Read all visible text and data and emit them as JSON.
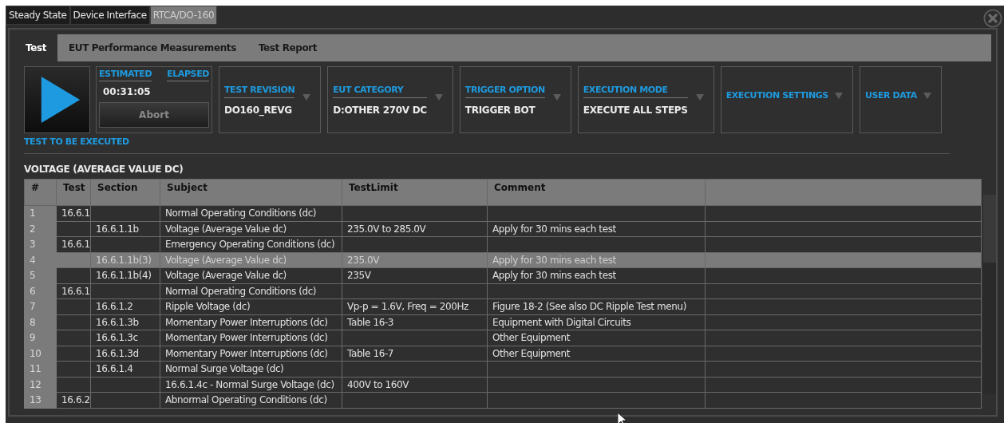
{
  "top_tabs": [
    {
      "label": "Steady State",
      "selected": false
    },
    {
      "label": "Device Interface",
      "selected": false
    },
    {
      "label": "RTCA/DO-160",
      "selected": true
    }
  ],
  "sub_tabs": [
    {
      "label": "Test",
      "selected": true
    },
    {
      "label": "EUT Performance Measurements",
      "selected": false
    },
    {
      "label": "Test Report",
      "selected": false
    }
  ],
  "run_panel": {
    "estimated_label": "ESTIMATED",
    "elapsed_label": "ELAPSED",
    "estimated_time": "00:31:05",
    "abort": {
      "label": "Abort",
      "disabled": true
    },
    "caption": "TEST TO BE EXECUTED"
  },
  "dropdowns": [
    {
      "label": "TEST REVISION",
      "value": "DO160_REVG"
    },
    {
      "label": "EUT CATEGORY",
      "value": "D:OTHER 270V DC"
    },
    {
      "label": "TRIGGER OPTION",
      "value": "TRIGGER BOT"
    },
    {
      "label": "EXECUTION MODE",
      "value": "EXECUTE ALL STEPS"
    },
    {
      "label": "EXECUTION SETTINGS"
    },
    {
      "label": "USER DATA"
    }
  ],
  "section_title": "VOLTAGE (AVERAGE VALUE DC)",
  "table": {
    "columns": [
      "#",
      "Test",
      "Section",
      "Subject",
      "TestLimit",
      "Comment"
    ],
    "rows": [
      {
        "cells": [
          "1",
          "16.6.1",
          "",
          "Normal Operating Conditions (dc)",
          "",
          ""
        ],
        "selected": false
      },
      {
        "cells": [
          "2",
          "",
          "16.6.1.1b",
          "Voltage (Average Value dc)",
          "235.0V to 285.0V",
          "Apply for 30 mins each test"
        ],
        "selected": false
      },
      {
        "cells": [
          "3",
          "16.6.1",
          "",
          "Emergency Operating Conditions (dc)",
          "",
          ""
        ],
        "selected": false
      },
      {
        "cells": [
          "4",
          "",
          "16.6.1.1b(3)",
          "Voltage (Average Value dc)",
          "235.0V",
          "Apply for 30 mins each test"
        ],
        "selected": true
      },
      {
        "cells": [
          "5",
          "",
          "16.6.1.1b(4)",
          "Voltage (Average Value dc)",
          "235V",
          "Apply for 30 mins each test"
        ],
        "selected": false
      },
      {
        "cells": [
          "6",
          "16.6.1",
          "",
          "Normal Operating Conditions (dc)",
          "",
          ""
        ],
        "selected": false
      },
      {
        "cells": [
          "7",
          "",
          "16.6.1.2",
          "Ripple Voltage (dc)",
          "Vp-p = 1.6V, Freq = 200Hz",
          "Figure 18-2 (See also DC Ripple Test menu)"
        ],
        "selected": false
      },
      {
        "cells": [
          "8",
          "",
          "16.6.1.3b",
          "Momentary Power Interruptions (dc)",
          "Table 16-3",
          "Equipment with Digital Circuits"
        ],
        "selected": false
      },
      {
        "cells": [
          "9",
          "",
          "16.6.1.3c",
          "Momentary Power Interruptions (dc)",
          "",
          "Other Equipment"
        ],
        "selected": false
      },
      {
        "cells": [
          "10",
          "",
          "16.6.1.3d",
          "Momentary Power Interruptions (dc)",
          "Table 16-7",
          "Other Equipment"
        ],
        "selected": false
      },
      {
        "cells": [
          "11",
          "",
          "16.6.1.4",
          "Normal Surge Voltage (dc)",
          "",
          ""
        ],
        "selected": false
      },
      {
        "cells": [
          "12",
          "",
          "",
          "16.6.1.4c - Normal Surge Voltage (dc)",
          "400V to 160V",
          ""
        ],
        "selected": false
      },
      {
        "cells": [
          "13",
          "16.6.2",
          "",
          "Abnormal Operating Conditions (dc)",
          "",
          ""
        ],
        "selected": false
      }
    ]
  }
}
